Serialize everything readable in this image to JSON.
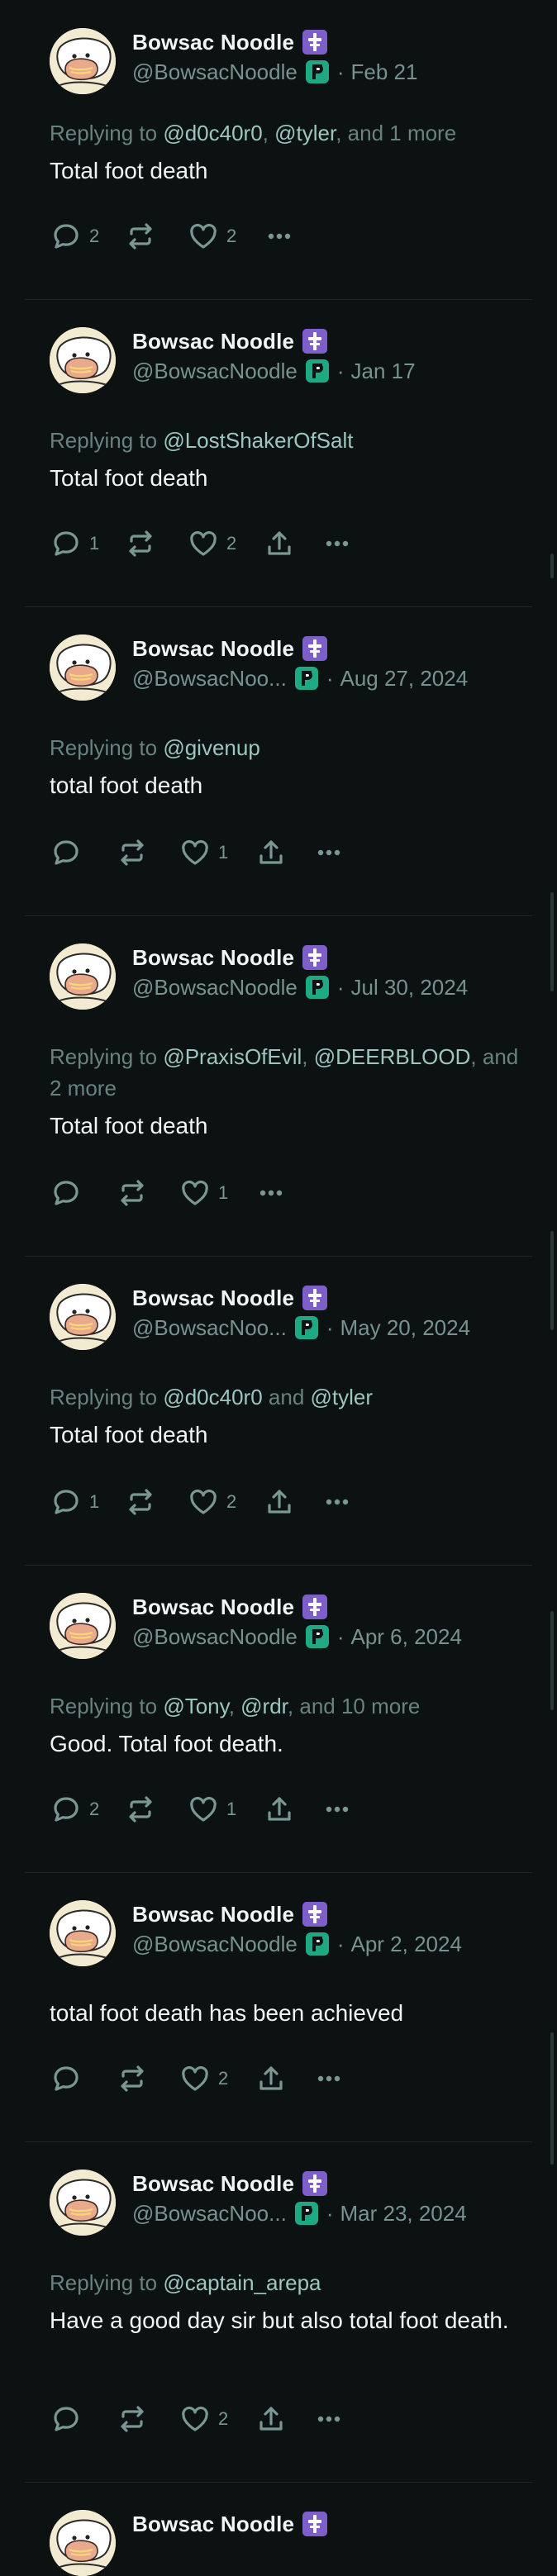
{
  "author": {
    "name": "Bowsac Noodle",
    "handle": "@BowsacNoodle"
  },
  "posts": [
    {
      "handle": "@BowsacNoodle",
      "date": "Feb 21",
      "reply": [
        {
          "t": "Replying to ",
          "m": false
        },
        {
          "t": "@d0c40r0",
          "m": true
        },
        {
          "t": ", ",
          "m": false
        },
        {
          "t": "@tyler",
          "m": true
        },
        {
          "t": ", and 1 more",
          "m": false
        }
      ],
      "text": "Total foot death",
      "replies": "2",
      "likes": "2",
      "share": false
    },
    {
      "handle": "@BowsacNoodle",
      "date": "Jan 17",
      "reply": [
        {
          "t": "Replying to ",
          "m": false
        },
        {
          "t": "@LostShakerOfSalt",
          "m": true
        }
      ],
      "text": "Total foot death",
      "replies": "1",
      "likes": "2",
      "share": true
    },
    {
      "handle": "@BowsacNoo...",
      "date": "Aug 27, 2024",
      "reply": [
        {
          "t": "Replying to ",
          "m": false
        },
        {
          "t": "@givenup",
          "m": true
        }
      ],
      "text": "total foot death",
      "replies": "",
      "likes": "1",
      "share": true
    },
    {
      "handle": "@BowsacNoodle",
      "date": "Jul 30, 2024",
      "reply": [
        {
          "t": "Replying to ",
          "m": false
        },
        {
          "t": "@PraxisOfEvil",
          "m": true
        },
        {
          "t": ", ",
          "m": false
        },
        {
          "t": "@DEERBLOOD",
          "m": true
        },
        {
          "t": ", and 2 more",
          "m": false
        }
      ],
      "text": "Total foot death",
      "replies": "",
      "likes": "1",
      "share": false
    },
    {
      "handle": "@BowsacNoo...",
      "date": "May 20, 2024",
      "reply": [
        {
          "t": "Replying to ",
          "m": false
        },
        {
          "t": "@d0c40r0",
          "m": true
        },
        {
          "t": " and ",
          "m": false
        },
        {
          "t": "@tyler",
          "m": true
        }
      ],
      "text": "Total foot death",
      "replies": "1",
      "likes": "2",
      "share": true
    },
    {
      "handle": "@BowsacNoodle",
      "date": "Apr 6, 2024",
      "reply": [
        {
          "t": "Replying to ",
          "m": false
        },
        {
          "t": "@Tony",
          "m": true
        },
        {
          "t": ", ",
          "m": false
        },
        {
          "t": "@rdr",
          "m": true
        },
        {
          "t": ", and 10 more",
          "m": false
        }
      ],
      "text": "Good. Total foot death.",
      "replies": "2",
      "likes": "1",
      "share": true
    },
    {
      "handle": "@BowsacNoodle",
      "date": "Apr 2, 2024",
      "reply": [],
      "text": "total foot death has been achieved",
      "replies": "",
      "likes": "2",
      "share": true
    },
    {
      "handle": "@BowsacNoo...",
      "date": "Mar 23, 2024",
      "reply": [
        {
          "t": "Replying to ",
          "m": false
        },
        {
          "t": "@captain_arepa",
          "m": true
        }
      ],
      "text": "Have a good day sir but also total foot death.",
      "replies": "",
      "likes": "2",
      "share": true
    },
    {
      "handle": "",
      "date": "",
      "reply": [],
      "text": "",
      "replies": "",
      "likes": "",
      "share": false
    }
  ],
  "icons": {
    "reply": "reply-icon",
    "repost": "repost-icon",
    "like": "heart-icon",
    "share": "share-icon",
    "more": "more-icon",
    "verified_mod": "purple-cross-badge-icon",
    "verified_p": "green-p-badge-icon"
  },
  "colors": {
    "background": "#0c1211",
    "mention": "#9bc7bd",
    "muted": "#76938d",
    "mod_badge": "#7e5fc9",
    "p_badge": "#1ea984"
  }
}
